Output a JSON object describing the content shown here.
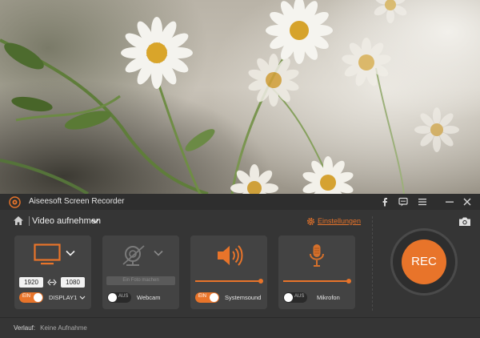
{
  "window": {
    "title": "Aiseesoft Screen Recorder"
  },
  "toolbar": {
    "mode_label": "Video aufnehmen",
    "settings_label": "Einstellungen"
  },
  "cards": {
    "display": {
      "width": "1920",
      "height": "1080",
      "toggle_label": "EIN",
      "toggle_on": true,
      "label": "DISPLAY1"
    },
    "webcam": {
      "bar_text": "Ein Foto machen",
      "toggle_label": "AUS",
      "toggle_on": false,
      "label": "Webcam"
    },
    "system_sound": {
      "volume_fraction": 1.0,
      "toggle_label": "EIN",
      "toggle_on": true,
      "label": "Systemsound"
    },
    "microphone": {
      "volume_fraction": 1.0,
      "toggle_label": "AUS",
      "toggle_on": false,
      "label": "Mikrofon"
    }
  },
  "rec_button": {
    "label": "REC"
  },
  "footer": {
    "history_label": "Verlauf:",
    "history_value": "Keine Aufnahme"
  },
  "colors": {
    "accent": "#e8742a",
    "panel_bg": "#353535",
    "card_bg": "#434343"
  },
  "icons": [
    "app-logo-icon",
    "facebook-icon",
    "feedback-icon",
    "menu-icon",
    "minimize-icon",
    "close-icon",
    "home-icon",
    "chevron-down-icon",
    "gear-icon",
    "camera-icon",
    "monitor-icon",
    "link-icon",
    "webcam-icon",
    "speaker-icon",
    "microphone-icon"
  ]
}
